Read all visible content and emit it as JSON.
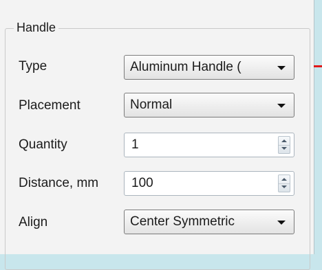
{
  "group": {
    "title": "Handle"
  },
  "rows": {
    "type": {
      "label": "Type",
      "value": "Aluminum Handle ("
    },
    "placement": {
      "label": "Placement",
      "value": "Normal"
    },
    "quantity": {
      "label": "Quantity",
      "value": "1"
    },
    "distance": {
      "label": "Distance, mm",
      "value": "100"
    },
    "align": {
      "label": "Align",
      "value": "Center Symmetric"
    }
  },
  "colors": {
    "background": "#c8e6ec",
    "panel": "#f3f3f3",
    "marker": "#e01919"
  }
}
